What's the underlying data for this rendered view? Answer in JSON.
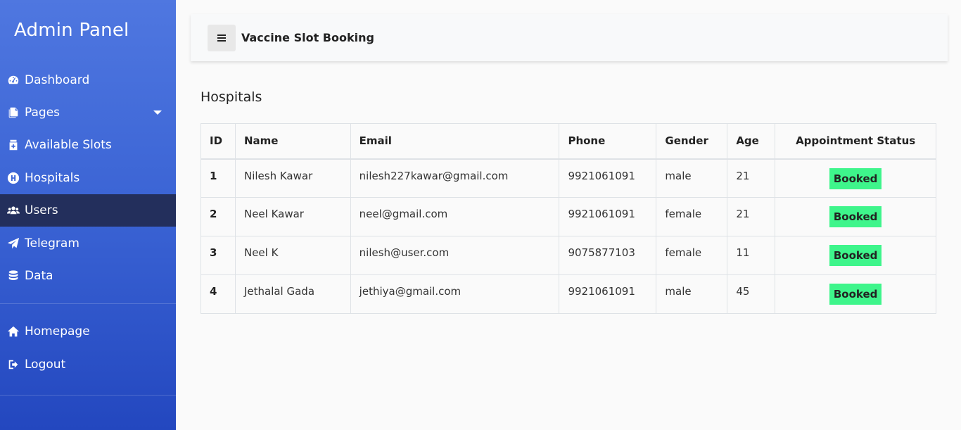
{
  "sidebar": {
    "title": "Admin Panel",
    "items": [
      {
        "label": "Dashboard",
        "icon": "dashboard-icon"
      },
      {
        "label": "Pages",
        "icon": "pages-icon"
      },
      {
        "label": "Available Slots",
        "icon": "slots-icon"
      },
      {
        "label": "Hospitals",
        "icon": "hospital-icon"
      },
      {
        "label": "Users",
        "icon": "users-icon",
        "active": true
      },
      {
        "label": "Telegram",
        "icon": "telegram-icon"
      },
      {
        "label": "Data",
        "icon": "database-icon"
      }
    ],
    "footer_items": [
      {
        "label": "Homepage",
        "icon": "home-icon"
      },
      {
        "label": "Logout",
        "icon": "logout-icon"
      }
    ]
  },
  "topbar": {
    "title": "Vaccine Slot Booking",
    "toggle_icon": "hamburger-icon"
  },
  "main": {
    "title": "Hospitals",
    "table": {
      "headers": [
        "ID",
        "Name",
        "Email",
        "Phone",
        "Gender",
        "Age",
        "Appointment Status"
      ],
      "rows": [
        {
          "id": "1",
          "name": "Nilesh Kawar",
          "email": "nilesh227kawar@gmail.com",
          "phone": "9921061091",
          "gender": "male",
          "age": "21",
          "status": "Booked"
        },
        {
          "id": "2",
          "name": "Neel Kawar",
          "email": "neel@gmail.com",
          "phone": "9921061091",
          "gender": "female",
          "age": "21",
          "status": "Booked"
        },
        {
          "id": "3",
          "name": "Neel K",
          "email": "nilesh@user.com",
          "phone": "9075877103",
          "gender": "female",
          "age": "11",
          "status": "Booked"
        },
        {
          "id": "4",
          "name": "Jethalal Gada",
          "email": "jethiya@gmail.com",
          "phone": "9921061091",
          "gender": "male",
          "age": "45",
          "status": "Booked"
        }
      ]
    }
  },
  "colors": {
    "sidebar_top": "#4f77e0",
    "sidebar_bottom": "#2347bf",
    "active_item": "#232f5c",
    "badge_booked": "#3ef58b"
  }
}
